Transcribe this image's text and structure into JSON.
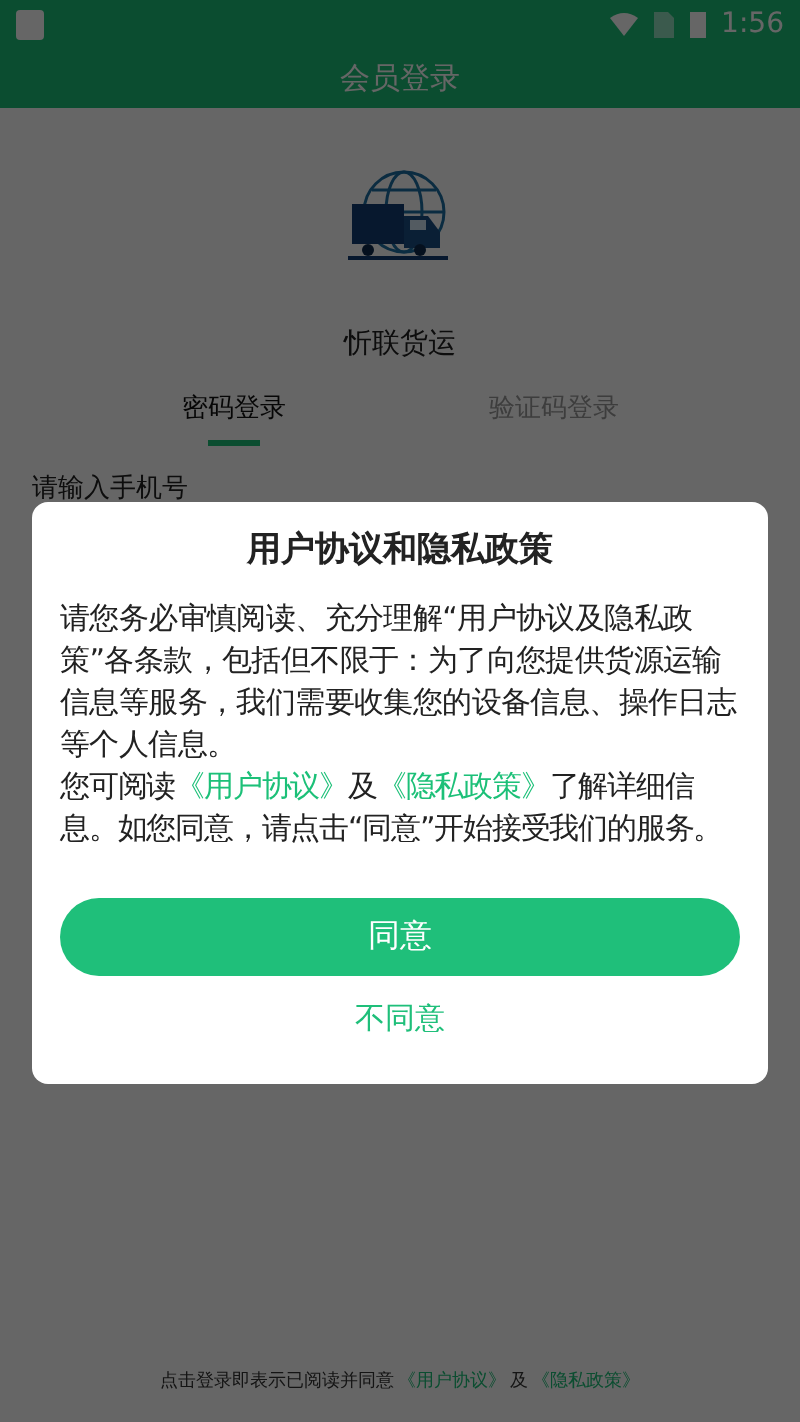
{
  "status_bar": {
    "time": "1:56"
  },
  "header": {
    "title": "会员登录"
  },
  "app_name": "忻联货运",
  "tabs": [
    {
      "label": "密码登录",
      "selected": true
    },
    {
      "label": "验证码登录",
      "selected": false
    }
  ],
  "phone_field": {
    "placeholder": "请输入手机号"
  },
  "footer": {
    "text": "点击登录即表示已阅读并同意",
    "link1": "《用户协议》",
    "joiner": "及",
    "link2": "《隐私政策》"
  },
  "dialog": {
    "title": "用户协议和隐私政策",
    "paragraph": "请您务必审慎阅读、充分理解“用户协议及隐私政策”各条款，包括但不限于：为了向您提供货源运输信息等服务，我们需要收集您的设备信息、操作日志等个人信息。",
    "read_prefix": "您可阅读",
    "link1": "《用户协议》",
    "joiner": "及",
    "link2": "《隐私政策》",
    "read_suffix": "了解详细信息。如您同意，请点击“同意”开始接受我们的服务。",
    "agree": "同意",
    "disagree": "不同意"
  }
}
